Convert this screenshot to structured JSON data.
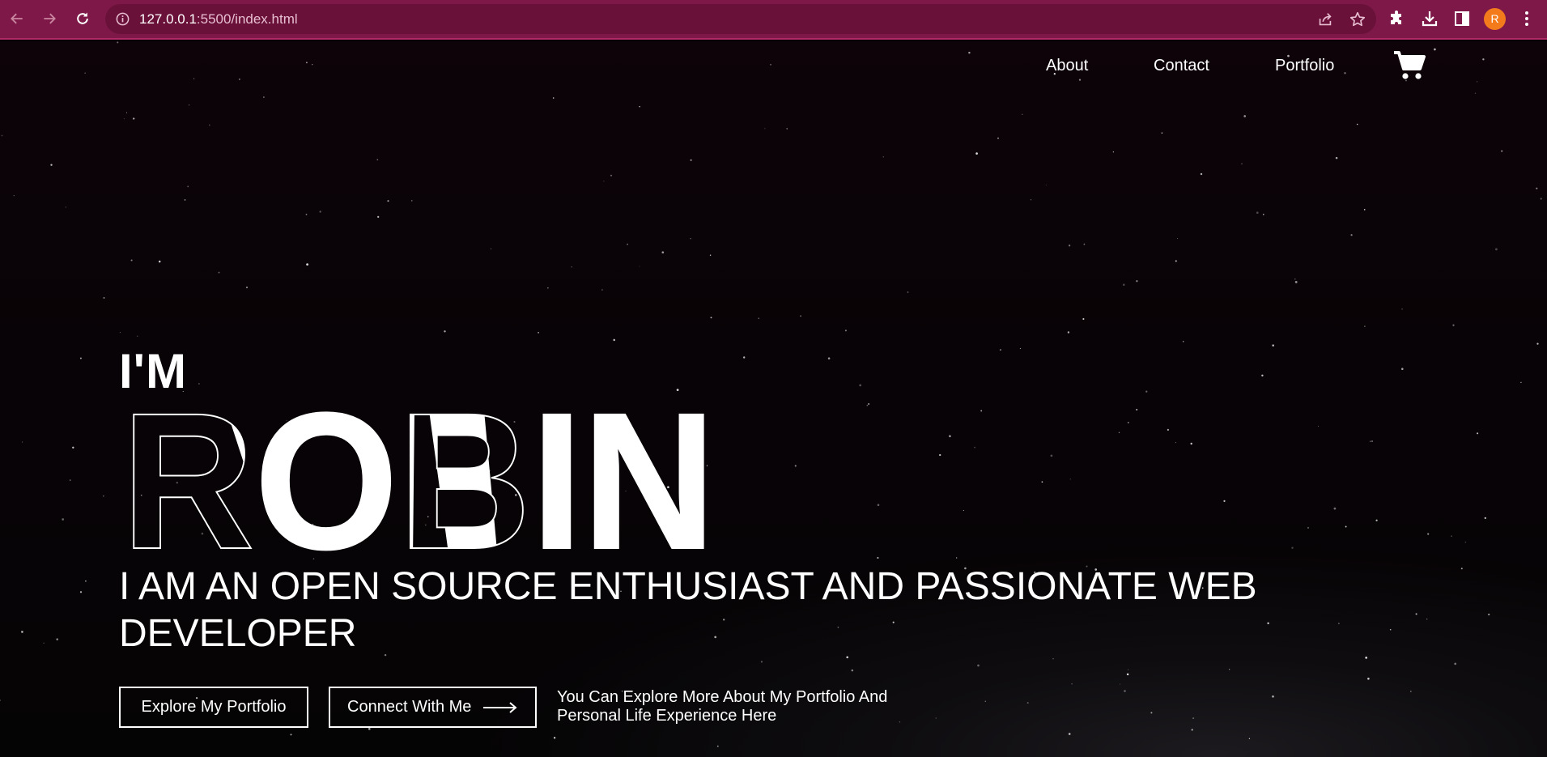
{
  "browser": {
    "url_host": "127.0.0.1",
    "url_rest": ":5500/index.html",
    "profile_initial": "R",
    "accent_color": "#7e1848"
  },
  "nav": {
    "links": [
      {
        "label": "About",
        "icon": ""
      },
      {
        "label": "Contact",
        "icon": ""
      },
      {
        "label": "Portfolio",
        "icon": ""
      }
    ],
    "cart_icon": "shopping-cart-icon"
  },
  "hero": {
    "intro": "I'M",
    "name": "ROBIN",
    "headline_line1": "I AM AN OPEN SOURCE ENTHUSIAST AND PASSIONATE WEB",
    "headline_line2": "DEVELOPER",
    "primary_button": "Explore My Portfolio",
    "secondary_button": "Connect With Me",
    "secondary_button_icon": "long-arrow-right-icon",
    "tagline_line1": "You Can Explore More About My Portfolio And",
    "tagline_line2": "Personal Life Experience Here"
  }
}
